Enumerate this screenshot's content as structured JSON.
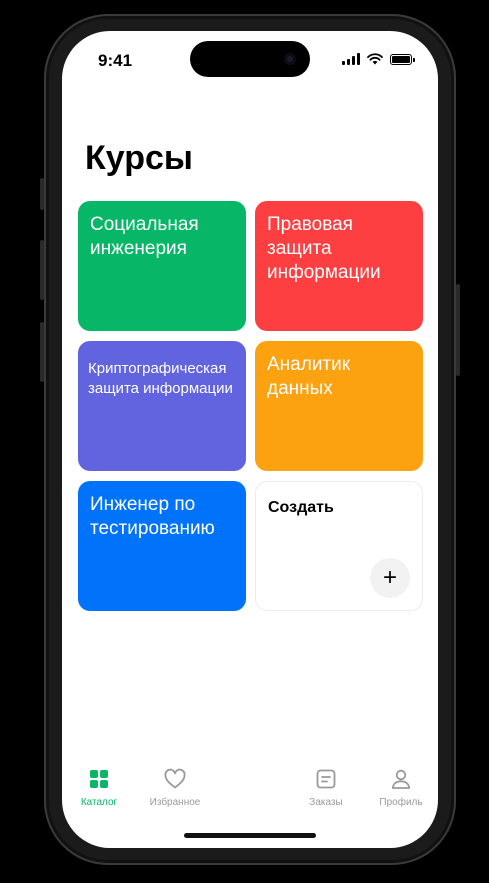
{
  "status_bar": {
    "time": "9:41"
  },
  "page": {
    "title": "Курсы"
  },
  "courses": [
    {
      "label": "Социальная инженерия",
      "color": "#07b767"
    },
    {
      "label": "Правовая защита информации",
      "color": "#fd3f42"
    },
    {
      "label": "Криптографическая защита информации",
      "color": "#6163df"
    },
    {
      "label": "Аналитик данных",
      "color": "#fca10f"
    },
    {
      "label": "Инженер по тестированию",
      "color": "#0173fb"
    }
  ],
  "create_card": {
    "label": "Создать",
    "plus": "+"
  },
  "tabbar": {
    "items": [
      {
        "label": "Каталог",
        "icon": "grid-icon",
        "active": true
      },
      {
        "label": "Избранное",
        "icon": "heart-icon",
        "active": false
      },
      {
        "label": "Заказы",
        "icon": "orders-icon",
        "active": false
      },
      {
        "label": "Профиль",
        "icon": "profile-icon",
        "active": false
      }
    ],
    "active_color": "#07b767",
    "inactive_color": "#9a9a9a"
  }
}
